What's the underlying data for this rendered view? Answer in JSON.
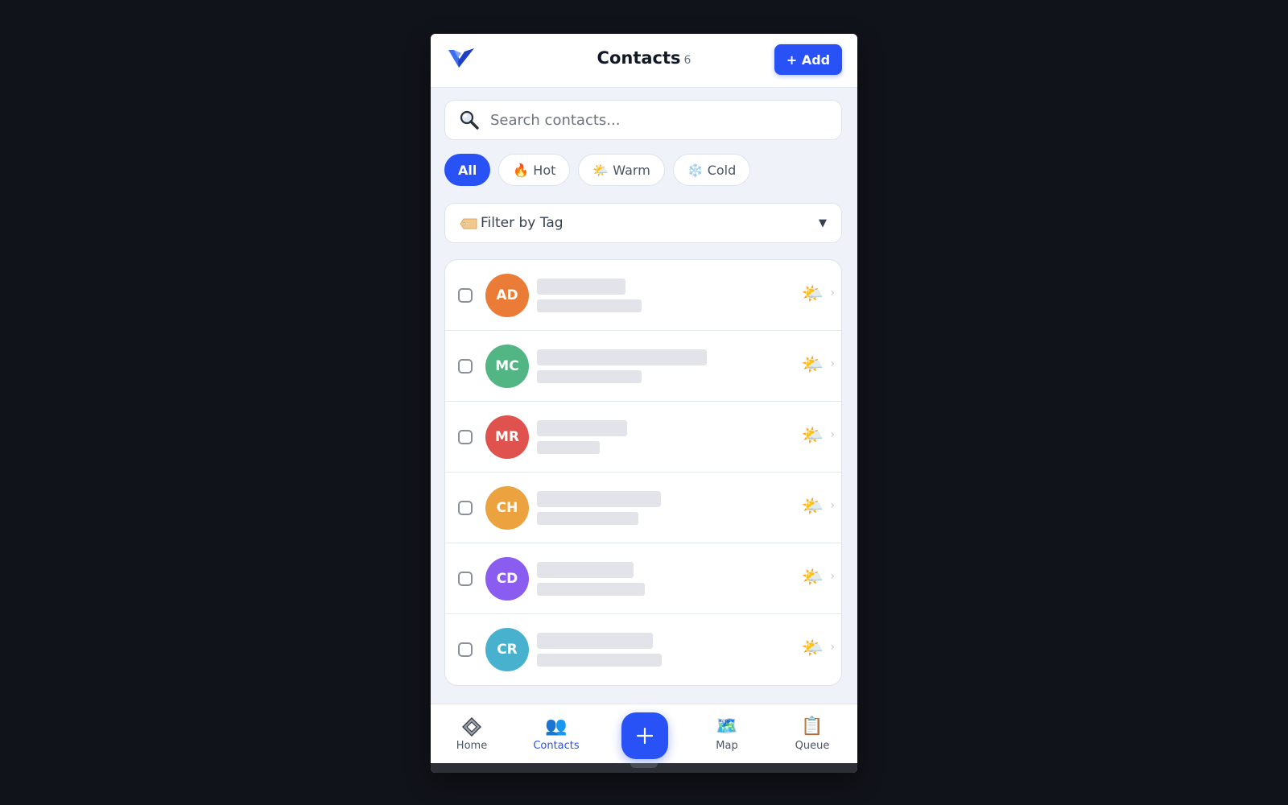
{
  "header": {
    "title": "Contacts",
    "count": "6",
    "add_label": "+ Add",
    "logo": "v-logo"
  },
  "search": {
    "placeholder": "Search contacts...",
    "value": "",
    "icon": "search-icon"
  },
  "filters": [
    {
      "label": "All",
      "emoji": "",
      "active": true
    },
    {
      "label": "Hot",
      "emoji": "🔥",
      "active": false
    },
    {
      "label": "Warm",
      "emoji": "🌤️",
      "active": false
    },
    {
      "label": "Cold",
      "emoji": "❄️",
      "active": false
    }
  ],
  "tag_filter": {
    "label": "Filter by Tag",
    "icon": "tag-icon",
    "caret": "▼"
  },
  "contacts": [
    {
      "initials": "AD",
      "color": "#ea7c37",
      "temperature": "warm"
    },
    {
      "initials": "MC",
      "color": "#52b584",
      "temperature": "warm"
    },
    {
      "initials": "MR",
      "color": "#e0524d",
      "temperature": "warm"
    },
    {
      "initials": "CH",
      "color": "#eba23f",
      "temperature": "warm"
    },
    {
      "initials": "CD",
      "color": "#8b5cf0",
      "temperature": "warm"
    },
    {
      "initials": "CR",
      "color": "#47b1ce",
      "temperature": "warm"
    }
  ],
  "nav": {
    "home": {
      "label": "Home",
      "icon": "◈"
    },
    "contacts": {
      "label": "Contacts",
      "icon": "👥"
    },
    "map": {
      "label": "Map",
      "icon": "🗺️"
    },
    "queue": {
      "label": "Queue",
      "icon": "📋"
    },
    "fab_label": "+"
  },
  "colors": {
    "accent": "#2852f5",
    "background": "#11131a",
    "panel": "#eff3f9"
  }
}
